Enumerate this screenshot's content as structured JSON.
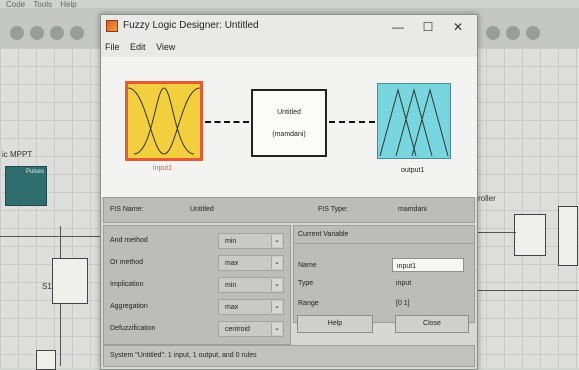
{
  "window": {
    "title": "Fuzzy Logic Designer: Untitled",
    "minimize": "—",
    "maximize": "☐",
    "close": "✕"
  },
  "menu": [
    "File",
    "Edit",
    "View"
  ],
  "background": {
    "menubar_items": [
      "Code",
      "Tools",
      "Help"
    ],
    "left_label": "ic MPPT",
    "teal_block_label": "Pulses",
    "right_label": "roller",
    "small_label": "S1"
  },
  "diagram": {
    "input_label": "input1",
    "output_label": "output1",
    "fis_name": "Untitled",
    "fis_type_paren": "(mamdani)",
    "input_color": "#f2cf3c",
    "input_border_color": "#e85a34",
    "output_color": "#77d6de"
  },
  "fis_info": {
    "name_label": "FIS Name:",
    "name_value": "Untitled",
    "type_label": "FIS Type:",
    "type_value": "mamdani"
  },
  "methods": [
    {
      "label": "And method",
      "value": "min"
    },
    {
      "label": "Or method",
      "value": "max"
    },
    {
      "label": "Implication",
      "value": "min"
    },
    {
      "label": "Aggregation",
      "value": "max"
    },
    {
      "label": "Defuzzification",
      "value": "centroid"
    }
  ],
  "current_variable": {
    "caption": "Current Variable",
    "name_label": "Name",
    "name_value": "input1",
    "type_label": "Type",
    "type_value": "input",
    "range_label": "Range",
    "range_value": "[0 1]"
  },
  "buttons": {
    "help": "Help",
    "close": "Close"
  },
  "status": "System \"Untitled\": 1 input, 1 output, and 0 rules"
}
